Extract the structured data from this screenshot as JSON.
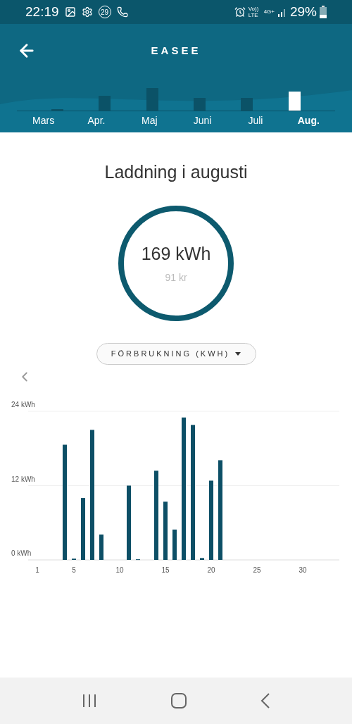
{
  "status_bar": {
    "time": "22:19",
    "notification_badge": "29",
    "network": "4G+",
    "volte": "Vo)) LTE",
    "battery": "29%"
  },
  "header": {
    "title": "EASEE"
  },
  "months": [
    {
      "label": "Mars",
      "selected": false
    },
    {
      "label": "Apr.",
      "selected": false
    },
    {
      "label": "Maj",
      "selected": false
    },
    {
      "label": "Juni",
      "selected": false
    },
    {
      "label": "Juli",
      "selected": false
    },
    {
      "label": "Aug.",
      "selected": true
    }
  ],
  "summary": {
    "heading": "Laddning i augusti",
    "energy": "169 kWh",
    "cost": "91 kr"
  },
  "metric_dropdown": {
    "label": "FÖRBRUKNING (KWH)"
  },
  "chart_data": {
    "type": "bar",
    "x": [
      4,
      5,
      6,
      7,
      8,
      11,
      12,
      14,
      15,
      16,
      17,
      18,
      19,
      20,
      21
    ],
    "series": [
      {
        "color": "#0d4f66",
        "values": [
          18.6,
          0.2,
          10,
          21,
          4.1,
          12,
          0.1,
          14.4,
          9.4,
          4.9,
          23,
          21.8,
          0.3,
          12.8,
          16.1
        ]
      }
    ],
    "xlim": [
      0,
      34
    ],
    "xticks": [
      1,
      5,
      10,
      15,
      20,
      25,
      30
    ],
    "ylim": [
      0,
      24
    ],
    "yticks": [
      {
        "value": 0,
        "label": "0 kWh"
      },
      {
        "value": 12,
        "label": "12 kWh"
      },
      {
        "value": 24,
        "label": "24 kWh"
      }
    ]
  }
}
